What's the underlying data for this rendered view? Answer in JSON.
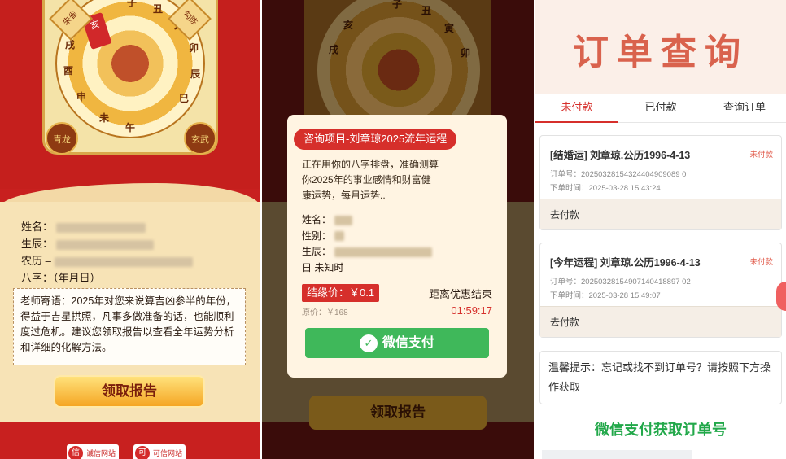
{
  "panel1": {
    "wheel": {
      "corners": [
        "朱雀",
        "勾陈",
        "青龙",
        "玄武"
      ],
      "branches": [
        "子",
        "丑",
        "寅",
        "卯",
        "辰",
        "巳",
        "午",
        "未",
        "申",
        "酉",
        "戌",
        "亥"
      ],
      "red_badge": "亥"
    },
    "info": {
      "name_label": "姓名：",
      "birth_label": "生辰：",
      "lunar_label": "农历 –",
      "bazi_label": "八字：（年月日）"
    },
    "teacher_note": "老师寄语：2025年对您来说算吉凶参半的年份，得益于吉星拱照，凡事多做准备的话，也能顺利度过危机。建议您领取报告以查看全年运势分析和详细的化解方法。",
    "claim_button": "领取报告",
    "footer_logos": [
      "诚信网站",
      "可信网站"
    ]
  },
  "panel2": {
    "claim_button": "领取报告",
    "modal": {
      "header": "咨询项目-刘章琼2025流年运程",
      "description": "正在用你的八字排盘，准确测算你2025年的事业感情和财富健康运势，每月运势..",
      "name_label": "姓名：",
      "gender_label": "性别：",
      "birth_label": "生辰：",
      "birth_tail": "日 未知时",
      "price_label": "结缘价：￥0.1",
      "original_price": "原价：￥168",
      "discount_label": "距离优惠结束",
      "countdown": "01:59:17",
      "pay_button": "微信支付"
    }
  },
  "panel3": {
    "title": "订单查询",
    "tabs": [
      "未付款",
      "已付款",
      "查询订单"
    ],
    "orders": [
      {
        "title": "[结婚运] 刘章琼.公历1996-4-13",
        "status": "未付款",
        "order_no": "订单号：20250328154324404909089 0",
        "time": "下单时间：2025-03-28 15:43:24",
        "action": "去付款"
      },
      {
        "title": "[今年运程] 刘章琼.公历1996-4-13",
        "status": "未付款",
        "order_no": "订单号：20250328154907140418897 02",
        "time": "下单时间：2025-03-28 15:49:07",
        "action": "去付款"
      }
    ],
    "tip": "温馨提示：忘记或找不到订单号？请按照下方操作获取",
    "guide_title": "微信支付获取订单号"
  },
  "colors": {
    "brand_red": "#d62f2b",
    "wechat_green": "#3fb85a",
    "title_orange": "#d9624d",
    "gold": "#f5a624"
  }
}
